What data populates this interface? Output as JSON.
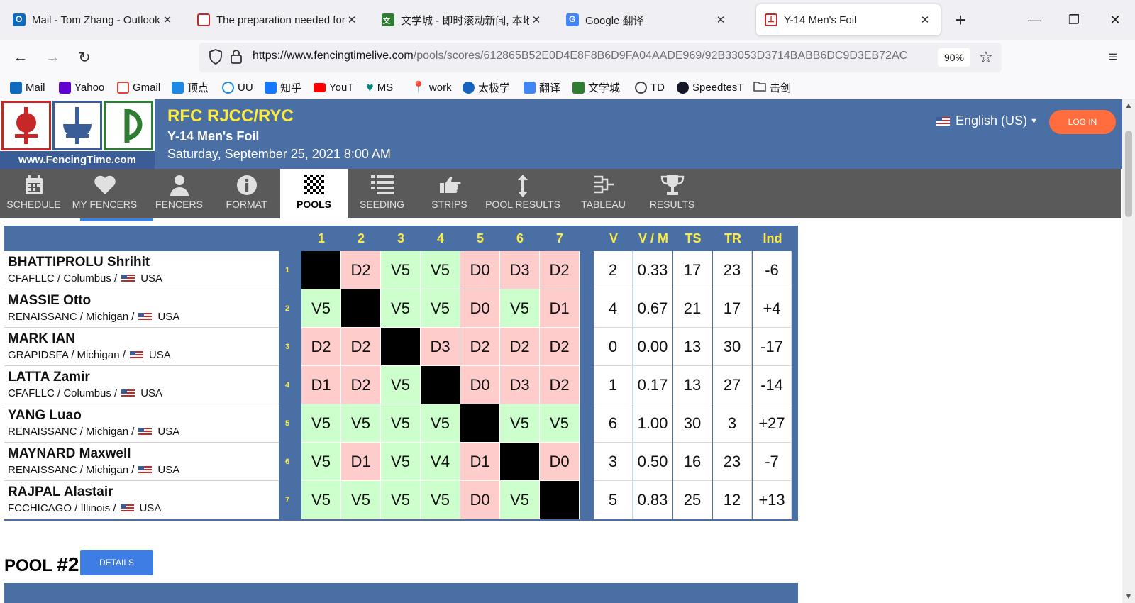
{
  "browser": {
    "tabs": [
      {
        "title": "Mail - Tom Zhang - Outlook",
        "icon": "outlook-icon",
        "color": "#0f6cbd"
      },
      {
        "title": "The preparation needed for th",
        "icon": "shield-logo-icon",
        "color": "#c62828"
      },
      {
        "title": "文学城 - 即时滚动新闻, 本地新",
        "icon": "wenxuecheng-icon",
        "color": "#2e7d32"
      },
      {
        "title": "Google 翻译",
        "icon": "google-translate-icon",
        "color": "#4285f4"
      },
      {
        "title": "Y-14 Men's Foil",
        "icon": "fencingtime-icon",
        "color": "#c62828"
      }
    ],
    "new_tab": "+",
    "url_host": "https://www.fencingtimelive.com",
    "url_path": "/pools/scores/612865B52E0D4E8F8B6D9FA04AADE969/92B33053D3714BABB6DC9D3EB72AC",
    "zoom": "90%",
    "bookmarks": [
      {
        "label": "Mail",
        "icon": "outlook-icon",
        "color": "#0f6cbd"
      },
      {
        "label": "Yahoo",
        "icon": "yahoo-icon",
        "color": "#6001d2"
      },
      {
        "label": "Gmail",
        "icon": "gmail-icon",
        "color": "#ea4335"
      },
      {
        "label": "顶点",
        "icon": "dingdian-icon",
        "color": "#1e88e5"
      },
      {
        "label": "UU",
        "icon": "uu-icon",
        "color": "#1e88e5"
      },
      {
        "label": "知乎",
        "icon": "zhihu-icon",
        "color": "#1677ff"
      },
      {
        "label": "YouT",
        "icon": "youtube-icon",
        "color": "#ff0000"
      },
      {
        "label": "MS",
        "icon": "heart-icon",
        "color": "#00897b"
      },
      {
        "label": "work",
        "icon": "map-pin-icon",
        "color": "#34a853"
      },
      {
        "label": "太极学",
        "icon": "people-icon",
        "color": "#1565c0"
      },
      {
        "label": "翻译",
        "icon": "google-translate-icon",
        "color": "#4285f4"
      },
      {
        "label": "文学城",
        "icon": "wenxuecheng-icon",
        "color": "#2e7d32"
      },
      {
        "label": "TD",
        "icon": "globe-icon",
        "color": "#444444"
      },
      {
        "label": "SpeedtesT",
        "icon": "speedtest-icon",
        "color": "#141526"
      },
      {
        "label": "击剑",
        "icon": "folder-icon",
        "color": "#444444"
      }
    ]
  },
  "site": {
    "logo_caption": "www.FencingTime.com",
    "event_title": "RFC RJCC/RYC",
    "event_subtitle": "Y-14 Men's Foil",
    "event_date": "Saturday, September 25, 2021 8:00 AM",
    "language": "English (US)",
    "login": "LOG IN",
    "colors": {
      "header": "#4a6fa5",
      "title_yellow": "#ffeb3b",
      "login": "#ff6d3f",
      "victory": "#ccffcc",
      "defeat": "#ffcccc"
    }
  },
  "menu": [
    {
      "label": "SCHEDULE",
      "icon": "calendar-icon"
    },
    {
      "label": "MY FENCERS",
      "icon": "heart-icon"
    },
    {
      "label": "FENCERS",
      "icon": "person-icon"
    },
    {
      "label": "FORMAT",
      "icon": "info-icon"
    },
    {
      "label": "POOLS",
      "icon": "grid-icon",
      "active": true
    },
    {
      "label": "SEEDING",
      "icon": "list-icon"
    },
    {
      "label": "STRIPS",
      "icon": "hand-point-icon"
    },
    {
      "label": "POOL RESULTS",
      "icon": "arrows-vertical-icon"
    },
    {
      "label": "TABLEAU",
      "icon": "bracket-icon"
    },
    {
      "label": "RESULTS",
      "icon": "trophy-icon"
    }
  ],
  "pool": {
    "bout_headers": [
      "1",
      "2",
      "3",
      "4",
      "5",
      "6",
      "7"
    ],
    "stat_headers": [
      "V",
      "V / M",
      "TS",
      "TR",
      "Ind"
    ],
    "fencers": [
      {
        "num": "1",
        "name": "BHATTIPROLU Shrihit",
        "club": "CFAFLLC / Columbus /",
        "country": "USA",
        "results": [
          "",
          "D2",
          "V5",
          "V5",
          "D0",
          "D3",
          "D2"
        ],
        "stats": [
          "2",
          "0.33",
          "17",
          "23",
          "-6"
        ]
      },
      {
        "num": "2",
        "name": "MASSIE Otto",
        "club": "RENAISSANC / Michigan /",
        "country": "USA",
        "results": [
          "V5",
          "",
          "V5",
          "V5",
          "D0",
          "V5",
          "D1"
        ],
        "stats": [
          "4",
          "0.67",
          "21",
          "17",
          "+4"
        ]
      },
      {
        "num": "3",
        "name": "MARK IAN",
        "club": "GRAPIDSFA / Michigan /",
        "country": "USA",
        "results": [
          "D2",
          "D2",
          "",
          "D3",
          "D2",
          "D2",
          "D2"
        ],
        "stats": [
          "0",
          "0.00",
          "13",
          "30",
          "-17"
        ]
      },
      {
        "num": "4",
        "name": "LATTA Zamir",
        "club": "CFAFLLC / Columbus /",
        "country": "USA",
        "results": [
          "D1",
          "D2",
          "V5",
          "",
          "D0",
          "D3",
          "D2"
        ],
        "stats": [
          "1",
          "0.17",
          "13",
          "27",
          "-14"
        ]
      },
      {
        "num": "5",
        "name": "YANG Luao",
        "club": "RENAISSANC / Michigan /",
        "country": "USA",
        "results": [
          "V5",
          "V5",
          "V5",
          "V5",
          "",
          "V5",
          "V5"
        ],
        "stats": [
          "6",
          "1.00",
          "30",
          "3",
          "+27"
        ]
      },
      {
        "num": "6",
        "name": "MAYNARD Maxwell",
        "club": "RENAISSANC / Michigan /",
        "country": "USA",
        "results": [
          "V5",
          "D1",
          "V5",
          "V4",
          "D1",
          "",
          "D0"
        ],
        "stats": [
          "3",
          "0.50",
          "16",
          "23",
          "-7"
        ]
      },
      {
        "num": "7",
        "name": "RAJPAL Alastair",
        "club": "FCCHICAGO / Illinois /",
        "country": "USA",
        "results": [
          "V5",
          "V5",
          "V5",
          "V5",
          "D0",
          "V5",
          ""
        ],
        "stats": [
          "5",
          "0.83",
          "25",
          "12",
          "+13"
        ]
      }
    ]
  },
  "pool2": {
    "label": "POOL",
    "number": "#2",
    "details": "DETAILS"
  }
}
